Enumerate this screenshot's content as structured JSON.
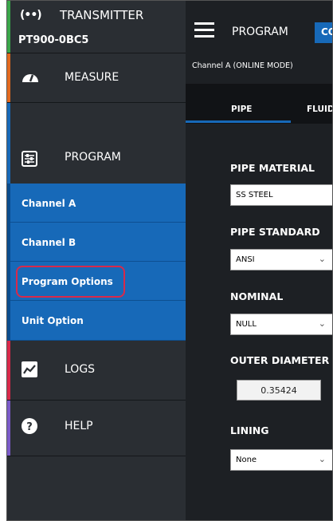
{
  "sidebar": {
    "header": {
      "broadcast_icon": "(••)",
      "title": "TRANSMITTER",
      "serial": "PT900-0BC5"
    },
    "measure": {
      "label": "MEASURE",
      "icon": "gauge-icon",
      "accent": "#e36a1f"
    },
    "program": {
      "label": "PROGRAM",
      "icon": "sliders-icon",
      "accent": "#1769b8"
    },
    "sub_items": [
      "Channel A",
      "Channel B",
      "Program Options",
      "Unit Option"
    ],
    "logs": {
      "label": "LOGS",
      "icon": "trend-chart-icon",
      "accent": "#d9294a"
    },
    "help": {
      "label": "HELP",
      "icon": "question-icon",
      "accent": "#7b5bc9"
    },
    "header_accent": "#3aa64a",
    "highlight_color": "#d9294a"
  },
  "topbar": {
    "title": "PROGRAM",
    "button_label": "CO",
    "channel_mode": "Channel A (ONLINE MODE)"
  },
  "tabs": [
    "PIPE",
    "FLUID"
  ],
  "form": {
    "pipe_material": {
      "label": "PIPE MATERIAL",
      "value": "SS STEEL"
    },
    "pipe_standard": {
      "label": "PIPE STANDARD",
      "value": "ANSI"
    },
    "nominal": {
      "label": "NOMINAL",
      "value": "NULL"
    },
    "outer_diameter": {
      "label": "OUTER DIAMETER",
      "value": "0.35424"
    },
    "lining": {
      "label": "LINING",
      "value": "None"
    }
  },
  "colors": {
    "accent_blue": "#1769b8",
    "background": "#1d2024"
  }
}
